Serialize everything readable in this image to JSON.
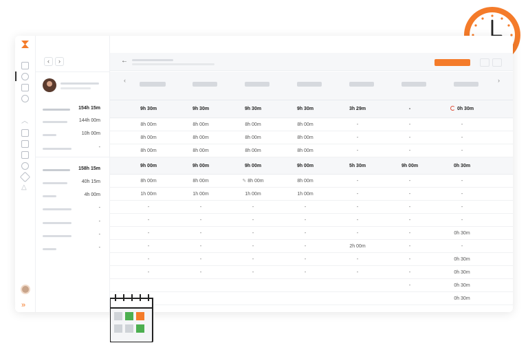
{
  "panel": {
    "prev_label": "‹",
    "next_label": "›",
    "summary": [
      {
        "value": "154h 15m",
        "bold": true
      },
      {
        "value": "144h 00m",
        "bold": false
      },
      {
        "value": "10h 00m",
        "bold": false
      },
      {
        "value": "-",
        "bold": false
      },
      {
        "value": "158h 15m",
        "bold": true
      },
      {
        "value": "40h 15m",
        "bold": false
      },
      {
        "value": "4h 00m",
        "bold": false
      },
      {
        "value": "-",
        "bold": false
      },
      {
        "value": "-",
        "bold": false
      },
      {
        "value": "-",
        "bold": false
      },
      {
        "value": "-",
        "bold": false
      }
    ]
  },
  "topbar": {
    "back_label": "←"
  },
  "header": {
    "prev_label": "‹",
    "next_label": "›"
  },
  "rows": [
    {
      "section": true,
      "cells": [
        "9h 30m",
        "9h 30m",
        "9h 30m",
        "9h 30m",
        "3h 29m",
        "-",
        "0h 30m"
      ],
      "moon_col": 6
    },
    {
      "section": false,
      "cells": [
        "8h 00m",
        "8h 00m",
        "8h 00m",
        "8h 00m",
        "-",
        "-",
        "-"
      ]
    },
    {
      "section": false,
      "cells": [
        "8h 00m",
        "8h 00m",
        "8h 00m",
        "8h 00m",
        "-",
        "-",
        "-"
      ]
    },
    {
      "section": false,
      "cells": [
        "8h 00m",
        "8h 00m",
        "8h 00m",
        "8h 00m",
        "-",
        "-",
        "-"
      ]
    },
    {
      "section": true,
      "cells": [
        "9h 00m",
        "9h 00m",
        "9h 00m",
        "9h 00m",
        "5h 30m",
        "9h 00m",
        "0h 30m"
      ]
    },
    {
      "section": false,
      "cells": [
        "8h 00m",
        "8h 00m",
        "8h 00m",
        "8h 00m",
        "-",
        "-",
        "-"
      ],
      "pencil_col": 2
    },
    {
      "section": false,
      "cells": [
        "1h 00m",
        "1h 00m",
        "1h 00m",
        "1h 00m",
        "-",
        "-",
        "-"
      ]
    },
    {
      "section": false,
      "cells": [
        "-",
        "-",
        "-",
        "-",
        "-",
        "-",
        "-"
      ]
    },
    {
      "section": false,
      "cells": [
        "-",
        "-",
        "-",
        "-",
        "-",
        "-",
        "-"
      ]
    },
    {
      "section": false,
      "cells": [
        "-",
        "-",
        "-",
        "-",
        "-",
        "-",
        "0h 30m"
      ]
    },
    {
      "section": false,
      "cells": [
        "-",
        "-",
        "-",
        "-",
        "2h 00m",
        "-",
        "-"
      ]
    },
    {
      "section": false,
      "cells": [
        "-",
        "-",
        "-",
        "-",
        "-",
        "-",
        "0h 30m"
      ]
    },
    {
      "section": false,
      "cells": [
        "-",
        "-",
        "-",
        "-",
        "-",
        "-",
        "0h 30m"
      ]
    },
    {
      "section": false,
      "cells": [
        "",
        "",
        "",
        "",
        "",
        "-",
        "0h 30m"
      ]
    },
    {
      "section": false,
      "cells": [
        "",
        "",
        "",
        "",
        "",
        "",
        "0h 30m"
      ]
    }
  ],
  "sidebar_icons": [
    "dashboard-icon",
    "clock-icon",
    "clipboard-icon",
    "people-icon",
    "chevron-up-icon",
    "report-icon",
    "map-icon",
    "briefcase-icon",
    "shield-icon",
    "tag-icon",
    "network-icon"
  ],
  "colors": {
    "accent": "#f47b2a",
    "play": "#2db24a",
    "moon": "#e0533d"
  }
}
